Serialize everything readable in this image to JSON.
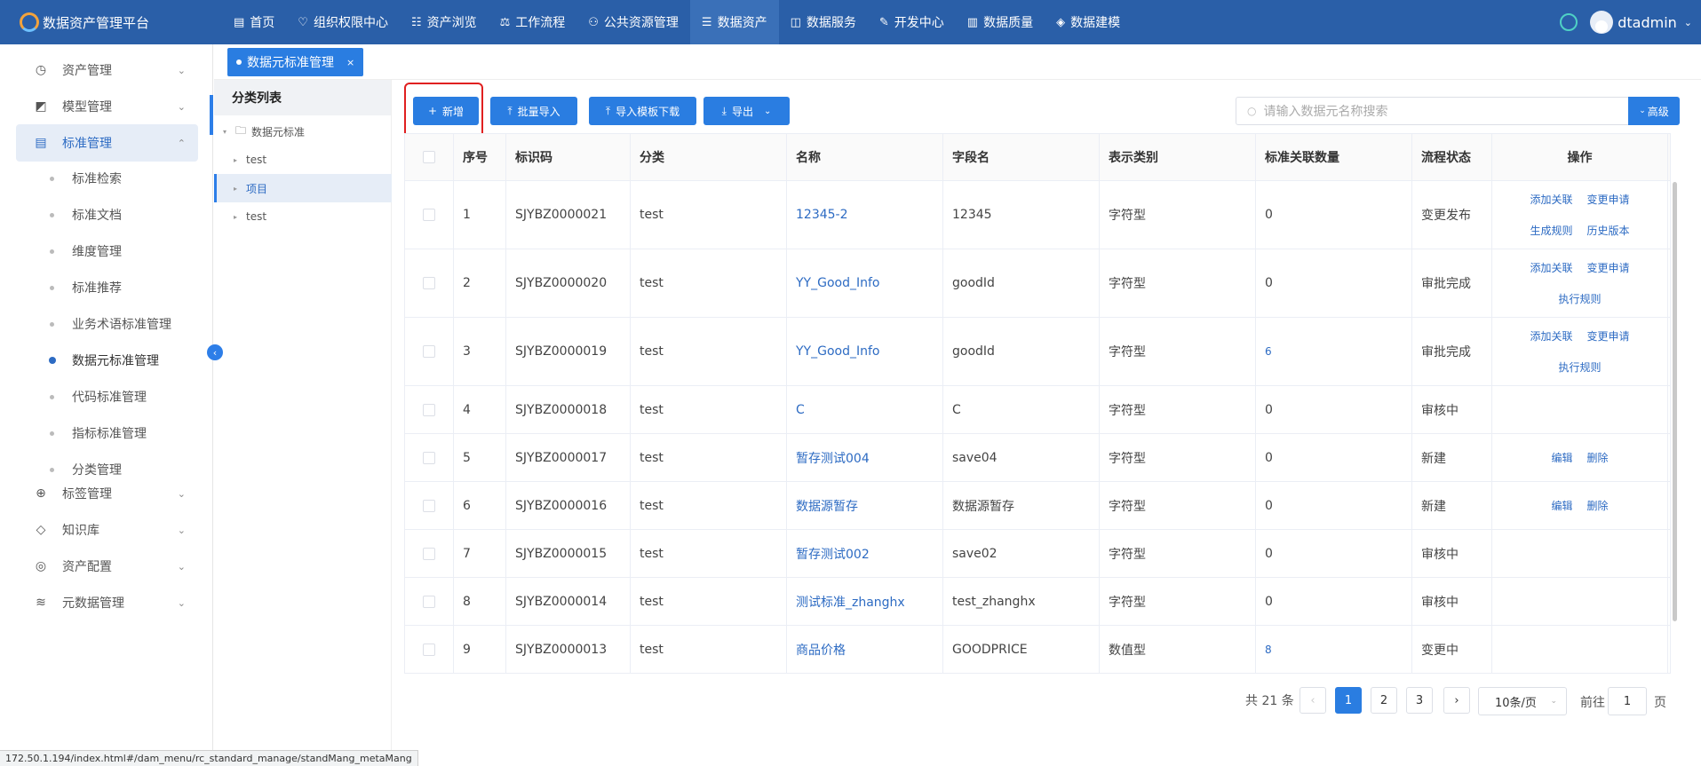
{
  "app": {
    "title": "数据资产管理平台",
    "username": "dtadmin"
  },
  "nav": [
    {
      "label": "首页",
      "icon": "home-icon",
      "glyph": "▤"
    },
    {
      "label": "组织权限中心",
      "icon": "shield-heart-icon",
      "glyph": "♡"
    },
    {
      "label": "资产浏览",
      "icon": "list-icon",
      "glyph": "☷"
    },
    {
      "label": "工作流程",
      "icon": "flow-icon",
      "glyph": "⚖"
    },
    {
      "label": "公共资源管理",
      "icon": "people-icon",
      "glyph": "⚇"
    },
    {
      "label": "数据资产",
      "icon": "chat-icon",
      "glyph": "☰"
    },
    {
      "label": "数据服务",
      "icon": "chart-icon",
      "glyph": "◫"
    },
    {
      "label": "开发中心",
      "icon": "edit-icon",
      "glyph": "✎"
    },
    {
      "label": "数据质量",
      "icon": "bar-chart-icon",
      "glyph": "▥"
    },
    {
      "label": "数据建模",
      "icon": "layers-icon",
      "glyph": "◈"
    }
  ],
  "sidebar": {
    "items": [
      {
        "label": "资产管理",
        "glyph": "◷"
      },
      {
        "label": "模型管理",
        "glyph": "◩"
      },
      {
        "label": "标准管理",
        "glyph": "▤"
      },
      {
        "label": "标签管理",
        "glyph": "⊕"
      },
      {
        "label": "知识库",
        "glyph": "◇"
      },
      {
        "label": "资产配置",
        "glyph": "◎"
      },
      {
        "label": "元数据管理",
        "glyph": "≋"
      }
    ],
    "sub_items": [
      "标准检索",
      "标准文档",
      "维度管理",
      "标准推荐",
      "业务术语标准管理",
      "数据元标准管理",
      "代码标准管理",
      "指标标准管理",
      "分类管理"
    ]
  },
  "tab": {
    "label": "数据元标准管理",
    "close": "×"
  },
  "category": {
    "title": "分类列表",
    "root": "数据元标准",
    "children": [
      "test",
      "项目",
      "test"
    ]
  },
  "toolbar": {
    "add": "新增",
    "batch_import": "批量导入",
    "template_download": "导入模板下载",
    "export": "导出",
    "search_placeholder": "请输入数据元名称搜索",
    "advanced": "高级"
  },
  "table": {
    "headers": [
      "序号",
      "标识码",
      "分类",
      "名称",
      "字段名",
      "表示类别",
      "标准关联数量",
      "流程状态",
      "操作"
    ],
    "rows": [
      {
        "no": "1",
        "code": "SJYBZ0000021",
        "cat": "test",
        "name": "12345-2",
        "field": "12345",
        "type": "字符型",
        "count": "0",
        "status": "变更发布",
        "ops": [
          [
            "添加关联",
            "变更申请"
          ],
          [
            "生成规则",
            "历史版本"
          ]
        ]
      },
      {
        "no": "2",
        "code": "SJYBZ0000020",
        "cat": "test",
        "name": "YY_Good_Info",
        "field": "goodId",
        "type": "字符型",
        "count": "0",
        "status": "审批完成",
        "ops": [
          [
            "添加关联",
            "变更申请"
          ],
          [
            "执行规则"
          ]
        ]
      },
      {
        "no": "3",
        "code": "SJYBZ0000019",
        "cat": "test",
        "name": "YY_Good_Info",
        "field": "goodId",
        "type": "字符型",
        "count": "6",
        "status": "审批完成",
        "ops": [
          [
            "添加关联",
            "变更申请"
          ],
          [
            "执行规则"
          ]
        ]
      },
      {
        "no": "4",
        "code": "SJYBZ0000018",
        "cat": "test",
        "name": "C",
        "field": "C",
        "type": "字符型",
        "count": "0",
        "status": "审核中",
        "ops": []
      },
      {
        "no": "5",
        "code": "SJYBZ0000017",
        "cat": "test",
        "name": "暂存测试004",
        "field": "save04",
        "type": "字符型",
        "count": "0",
        "status": "新建",
        "ops": [
          [
            "编辑",
            "删除"
          ]
        ]
      },
      {
        "no": "6",
        "code": "SJYBZ0000016",
        "cat": "test",
        "name": "数据源暂存",
        "field": "数据源暂存",
        "type": "字符型",
        "count": "0",
        "status": "新建",
        "ops": [
          [
            "编辑",
            "删除"
          ]
        ]
      },
      {
        "no": "7",
        "code": "SJYBZ0000015",
        "cat": "test",
        "name": "暂存测试002",
        "field": "save02",
        "type": "字符型",
        "count": "0",
        "status": "审核中",
        "ops": []
      },
      {
        "no": "8",
        "code": "SJYBZ0000014",
        "cat": "test",
        "name": "测试标准_zhanghx",
        "field": "test_zhanghx",
        "type": "字符型",
        "count": "0",
        "status": "审核中",
        "ops": []
      },
      {
        "no": "9",
        "code": "SJYBZ0000013",
        "cat": "test",
        "name": "商品价格",
        "field": "GOODPRICE",
        "type": "数值型",
        "count": "8",
        "status": "变更中",
        "ops": []
      }
    ]
  },
  "pagination": {
    "total": "共 21 条",
    "prev": "‹",
    "next": "›",
    "pages": [
      "1",
      "2",
      "3"
    ],
    "size": "10条/页",
    "goto_label": "前往",
    "goto_value": "1",
    "goto_suffix": "页"
  },
  "status_url": "172.50.1.194/index.html#/dam_menu/rc_standard_manage/standMang_metaMang"
}
